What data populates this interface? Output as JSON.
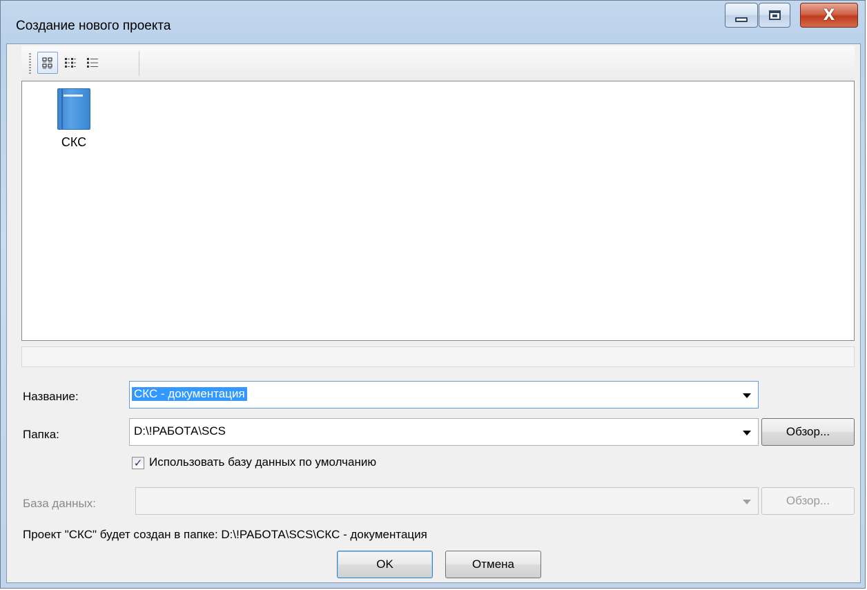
{
  "window": {
    "title": "Создание нового проекта"
  },
  "title_buttons": {
    "minimize": "minimize-icon",
    "maximize": "maximize-icon",
    "close_glyph": "X"
  },
  "toolbar": {
    "buttons": [
      "large-icons-view-icon",
      "small-icons-view-icon",
      "list-view-icon"
    ]
  },
  "templates": {
    "items": [
      {
        "label": "СКС",
        "icon": "blue-document-icon"
      }
    ]
  },
  "form": {
    "name_label": "Название:",
    "name_value": "СКС - документация",
    "folder_label": "Папка:",
    "folder_value": "D:\\!РАБОТА\\SCS",
    "browse_label": "Обзор...",
    "use_default_db_label": "Использовать базу данных по умолчанию",
    "use_default_db_checked": true,
    "database_label": "База данных:",
    "database_value": "",
    "database_browse_label": "Обзор...",
    "info_text": "Проект \"СКС\" будет создан в папке: D:\\!РАБОТА\\SCS\\СКС - документация"
  },
  "buttons": {
    "ok": "OK",
    "cancel": "Отмена"
  },
  "colors": {
    "selection": "#3399ff",
    "icon_blue": "#3c85cf"
  }
}
